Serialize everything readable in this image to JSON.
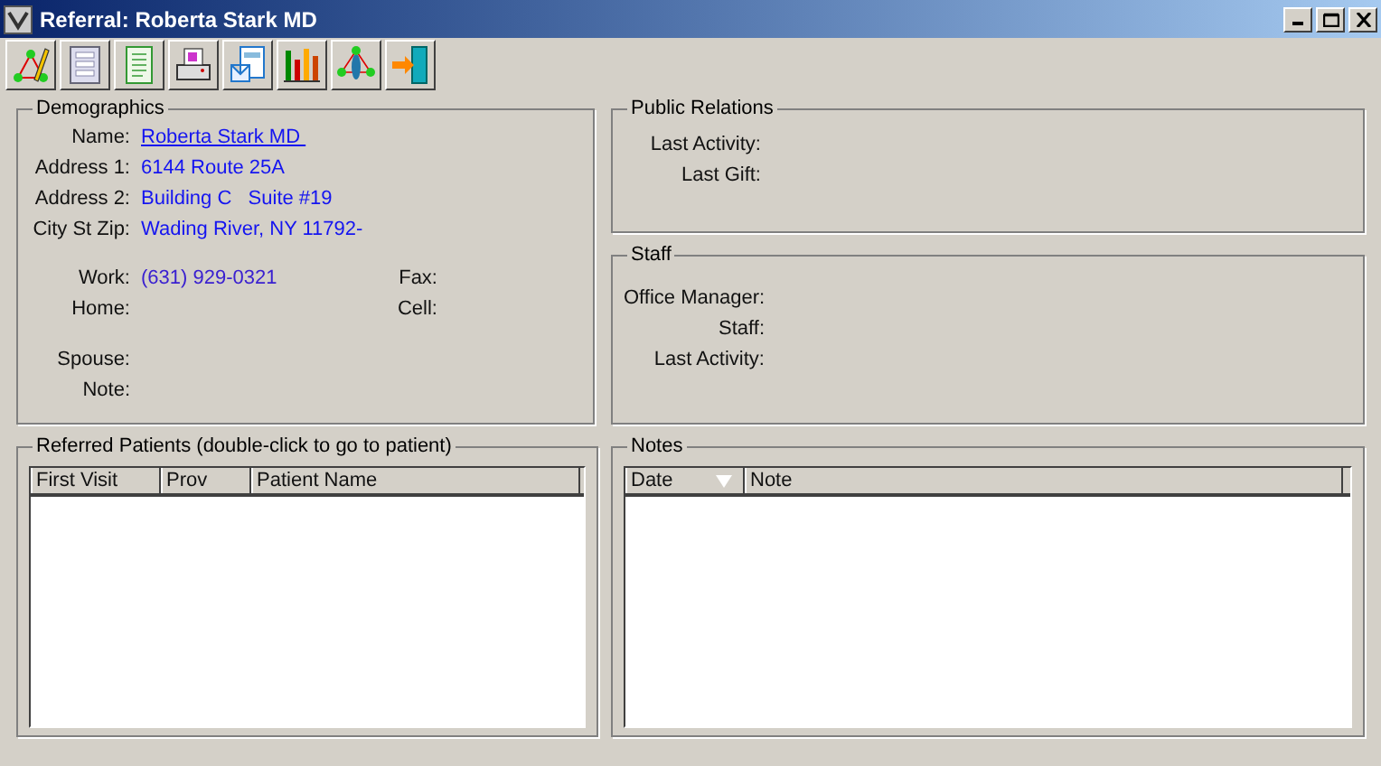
{
  "window": {
    "title": "Referral: Roberta Stark MD"
  },
  "demographics": {
    "title": "Demographics",
    "address_rows": [
      {
        "label": "Name:",
        "value": "Roberta Stark MD ",
        "kind": "link"
      },
      {
        "label": "Address 1:",
        "value": "6144 Route 25A",
        "kind": "text"
      },
      {
        "label": "Address 2:",
        "value": "Building C   Suite #19",
        "kind": "text"
      },
      {
        "label": "City St Zip:",
        "value": "Wading River, NY 11792-",
        "kind": "text"
      }
    ],
    "phone_rows": [
      {
        "label": "Work:",
        "value": "(631) 929-0321",
        "right_label": "Fax:"
      },
      {
        "label": "Home:",
        "right_label": "Cell:"
      }
    ],
    "other_rows": [
      {
        "label": "Spouse:"
      },
      {
        "label": "Note:"
      }
    ]
  },
  "public_relations": {
    "title": "Public Relations",
    "labels": [
      "Last Activity:",
      "Last Gift:"
    ]
  },
  "staff": {
    "title": "Staff",
    "labels": [
      "Office Manager:",
      "Staff:",
      "Last Activity:"
    ]
  },
  "referred_patients": {
    "title": "Referred Patients (double-click to go to patient)",
    "columns": [
      {
        "label": "First Visit",
        "sorted": false
      },
      {
        "label": "Prov",
        "sorted": false
      },
      {
        "label": "Patient Name",
        "sorted": false
      }
    ]
  },
  "notes": {
    "title": "Notes",
    "columns": [
      {
        "label": "Date",
        "sorted": true
      },
      {
        "label": "Note",
        "sorted": false
      }
    ]
  }
}
